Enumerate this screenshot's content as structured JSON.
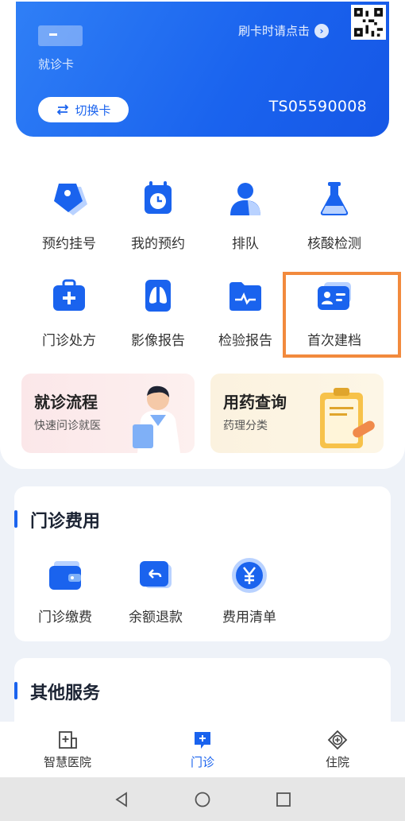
{
  "card": {
    "card_type": "就诊卡",
    "tap_hint": "刷卡时请点击",
    "switch_label": "切换卡",
    "card_number": "TS05590008"
  },
  "functions": [
    {
      "label": "预约挂号",
      "icon": "tag-icon"
    },
    {
      "label": "我的预约",
      "icon": "calendar-clock-icon"
    },
    {
      "label": "排队",
      "icon": "person-icon"
    },
    {
      "label": "核酸检测",
      "icon": "flask-icon"
    },
    {
      "label": "门诊处方",
      "icon": "medical-kit-icon"
    },
    {
      "label": "影像报告",
      "icon": "lungs-icon"
    },
    {
      "label": "检验报告",
      "icon": "folder-pulse-icon"
    },
    {
      "label": "首次建档",
      "icon": "id-card-icon"
    }
  ],
  "promos": [
    {
      "title": "就诊流程",
      "subtitle": "快速问诊就医"
    },
    {
      "title": "用药查询",
      "subtitle": "药理分类"
    }
  ],
  "outpatient_fees": {
    "title": "门诊费用",
    "items": [
      {
        "label": "门诊缴费",
        "icon": "wallet-icon"
      },
      {
        "label": "余额退款",
        "icon": "refund-icon"
      },
      {
        "label": "费用清单",
        "icon": "yen-icon"
      }
    ]
  },
  "other_services": {
    "title": "其他服务"
  },
  "bottom_nav": [
    {
      "label": "智慧医院",
      "icon": "hospital-icon",
      "active": false
    },
    {
      "label": "门诊",
      "icon": "clinic-icon",
      "active": true
    },
    {
      "label": "住院",
      "icon": "inpatient-icon",
      "active": false
    }
  ],
  "colors": {
    "primary": "#1a63ee",
    "highlight": "#f28a3d",
    "background": "#eef2f8"
  }
}
